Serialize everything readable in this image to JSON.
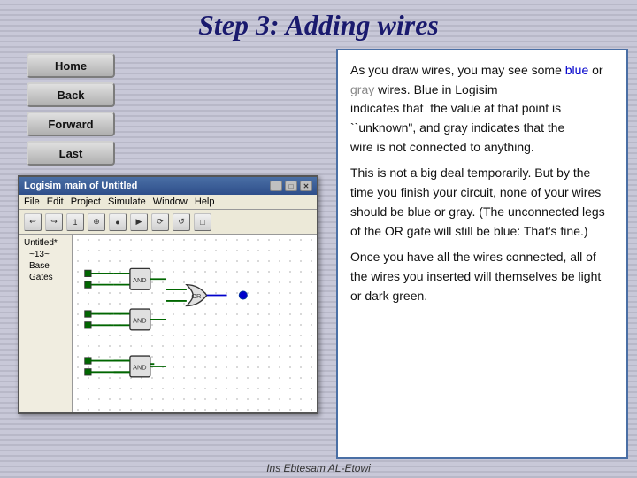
{
  "page": {
    "title": "Step 3: Adding wires",
    "footer": "Ins Ebtesam AL-Etowi"
  },
  "nav": {
    "home_label": "Home",
    "back_label": "Back",
    "forward_label": "Forward",
    "last_label": "Last"
  },
  "logisim": {
    "title": "Logisim main of Untitled",
    "menu_items": [
      "File",
      "Edit",
      "Project",
      "Simulate",
      "Window",
      "Help"
    ],
    "sidebar_items": [
      "Untitled*",
      "~13~",
      "Base",
      "Gates"
    ]
  },
  "content": {
    "paragraph1_start": "As you draw wires, you may see some ",
    "blue_word": "blue",
    "paragraph1_mid": " or ",
    "gray_word": "gray",
    "paragraph1_end": " wires. Blue in Logisim",
    "paragraph2": "indicates that  the value at that point is ``unknown\", and gray indicates that the wire is not connected to anything.",
    "paragraph3": "This is not a big deal temporarily. But by the time you finish your circuit, none of your wires should be blue or gray. (The unconnected legs of the OR gate will still be blue: That's fine.)",
    "paragraph4": "Once you have all the wires connected, all of the wires you inserted will themselves be light or dark green."
  },
  "colors": {
    "title": "#1a1a6e",
    "accent": "#4a6fa5",
    "blue_text": "#0000cc",
    "gray_text": "#888888"
  }
}
